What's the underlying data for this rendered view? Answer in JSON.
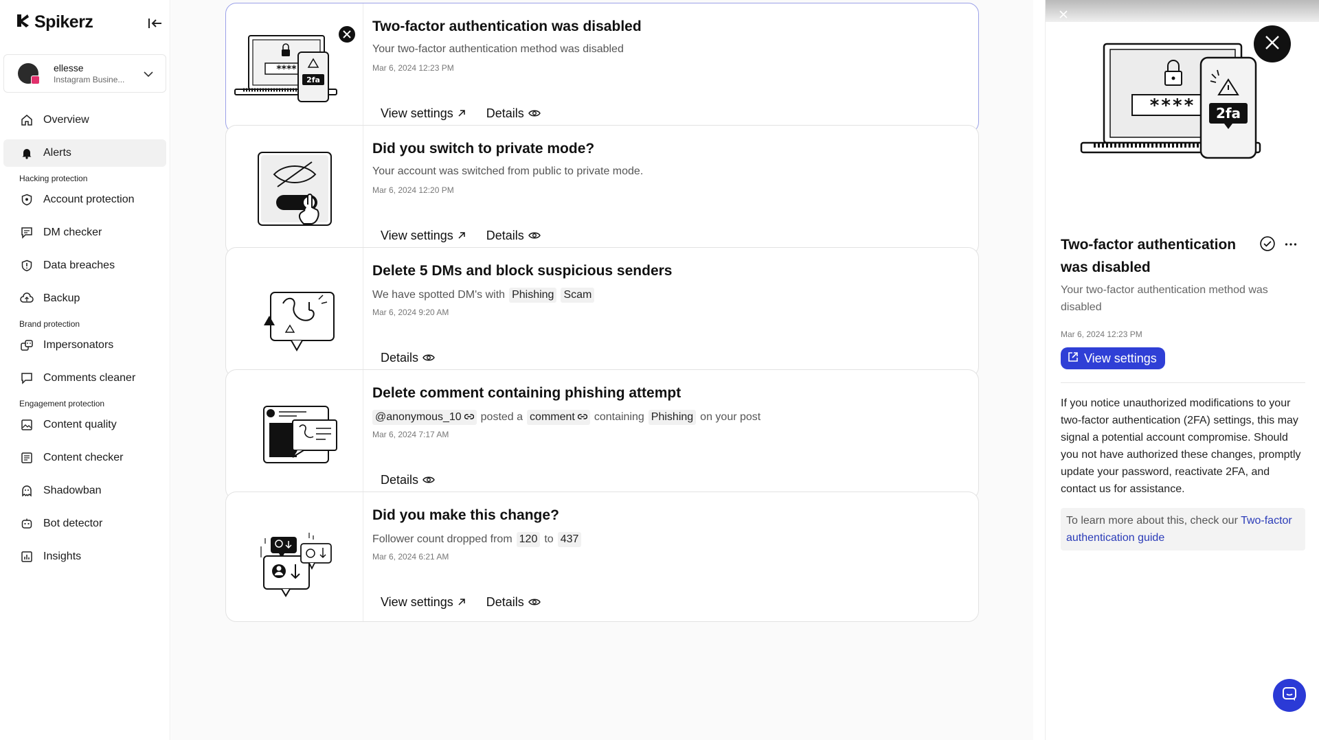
{
  "brand": {
    "name": "Spikerz"
  },
  "account": {
    "name": "ellesse",
    "type": "Instagram Busine..."
  },
  "nav": {
    "overview": "Overview",
    "alerts": "Alerts",
    "section_hacking": "Hacking protection",
    "account_protection": "Account protection",
    "dm_checker": "DM checker",
    "data_breaches": "Data breaches",
    "backup": "Backup",
    "section_brand": "Brand protection",
    "impersonators": "Impersonators",
    "comments_cleaner": "Comments cleaner",
    "section_engagement": "Engagement protection",
    "content_quality": "Content quality",
    "content_checker": "Content checker",
    "shadowban": "Shadowban",
    "bot_detector": "Bot detector",
    "insights": "Insights"
  },
  "actions": {
    "view_settings": "View settings",
    "details": "Details"
  },
  "alerts": [
    {
      "title": "Two-factor authentication was disabled",
      "desc": "Your two-factor authentication method was disabled",
      "date": "Mar 6, 2024 12:23 PM"
    },
    {
      "title": "Did you switch to private mode?",
      "desc": "Your account was switched from public to private mode.",
      "date": "Mar 6, 2024 12:20 PM"
    },
    {
      "title": "Delete 5 DMs and block suspicious senders",
      "desc_prefix": "We have spotted DM's with",
      "chip1": "Phishing",
      "chip2": "Scam",
      "date": "Mar 6, 2024 9:20 AM"
    },
    {
      "title": "Delete comment containing phishing attempt",
      "user": "@anonymous_10",
      "posted": "posted a",
      "comment": "comment",
      "containing": "containing",
      "chip": "Phishing",
      "suffix": "on your post",
      "date": "Mar 6, 2024 7:17 AM"
    },
    {
      "title": "Did you make this change?",
      "desc_prefix": "Follower count dropped from",
      "from": "120",
      "to_word": "to",
      "to": "437",
      "date": "Mar 6, 2024 6:21 AM"
    }
  ],
  "illustrations": {
    "password_mask": "****",
    "twofa_label": "2fa"
  },
  "panel": {
    "title": "Two-factor authentication was disabled",
    "desc": "Your two-factor authentication method was disabled",
    "date": "Mar 6, 2024 12:23 PM",
    "button": "View settings",
    "body": "If you notice unauthorized modifications to your two-factor authentication (2FA) settings, this may signal a potential account compromise. Should you not have authorized these changes, promptly update your password, reactivate 2FA, and contact us for assistance.",
    "note_prefix": "To learn more about this, check our",
    "note_link": "Two-factor authentication guide"
  },
  "colors": {
    "accent": "#2f3fd6",
    "selected_border": "#9aa0e8",
    "link": "#2a3bb8"
  },
  "icons": [
    "brand-logo-icon",
    "collapse-icon",
    "chevron-down-icon",
    "home-icon",
    "bell-icon",
    "shield-icon",
    "chat-icon",
    "backup-icon",
    "impersonator-icon",
    "comment-icon",
    "image-icon",
    "smiley-icon",
    "bot-icon",
    "chart-icon",
    "check-circle-icon",
    "more-icon",
    "external-arrow-icon",
    "eye-icon",
    "link-icon",
    "close-icon",
    "external-link-icon",
    "chat-bubble-icon"
  ]
}
